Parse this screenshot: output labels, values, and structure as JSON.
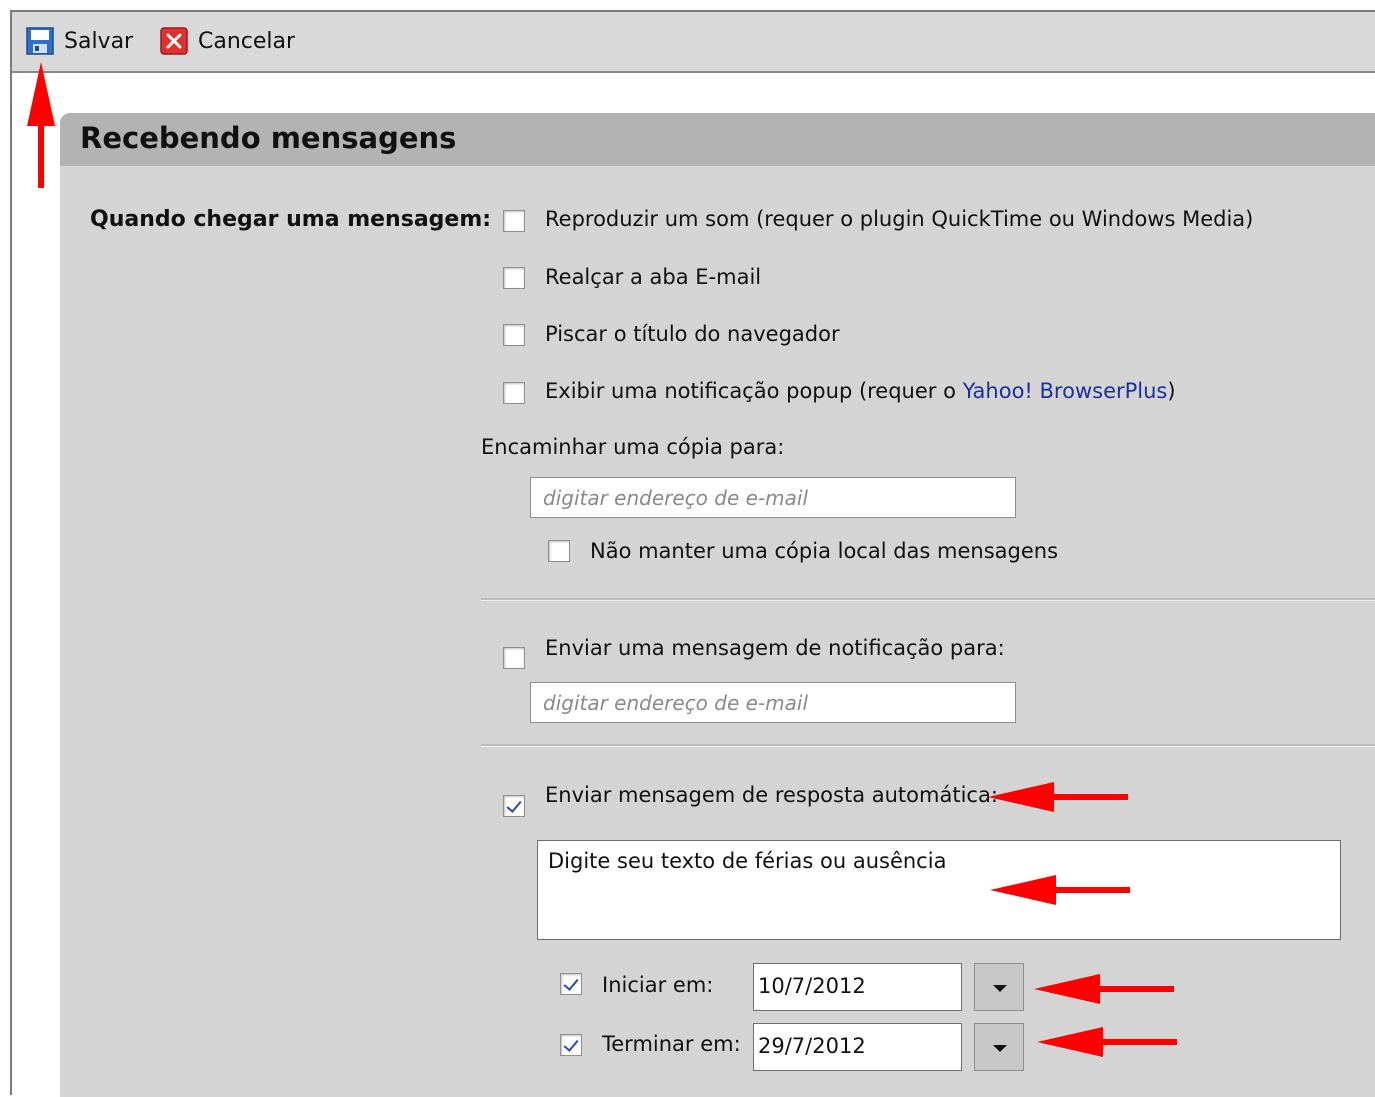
{
  "toolbar": {
    "save_label": "Salvar",
    "save_icon": "floppy-disk-icon",
    "cancel_label": "Cancelar",
    "cancel_icon": "close-x-icon"
  },
  "section": {
    "title": "Recebendo mensagens",
    "when_label": "Quando chegar uma mensagem:"
  },
  "options": {
    "play_sound": {
      "label": "Reproduzir um som (requer o plugin QuickTime ou Windows Media)",
      "checked": false
    },
    "highlight_tab": {
      "label": "Realçar a aba E-mail",
      "checked": false
    },
    "blink_title": {
      "label": "Piscar o título do navegador",
      "checked": false
    },
    "popup": {
      "label_prefix": "Exibir uma notificação popup (requer o ",
      "link": "Yahoo! BrowserPlus",
      "label_suffix": ")",
      "checked": false
    }
  },
  "forward": {
    "label": "Encaminhar uma cópia para:",
    "placeholder": "digitar endereço de e-mail",
    "value": "",
    "no_local_copy": {
      "label": "Não manter uma cópia local das mensagens",
      "checked": false
    }
  },
  "notify": {
    "label": "Enviar uma mensagem de notificação para:",
    "checked": false,
    "placeholder": "digitar endereço de e-mail",
    "value": ""
  },
  "auto_reply": {
    "label": "Enviar mensagem de resposta automática:",
    "checked": true,
    "text": "Digite seu texto de férias ou ausência",
    "start": {
      "label": "Iniciar em:",
      "checked": true,
      "value": "10/7/2012"
    },
    "end": {
      "label": "Terminar em:",
      "checked": true,
      "value": "29/7/2012"
    }
  },
  "colors": {
    "annotation_arrow": "#ff0000",
    "link": "#1a2fa0",
    "header": "#b3b3b3",
    "panel": "#d4d4d4"
  }
}
